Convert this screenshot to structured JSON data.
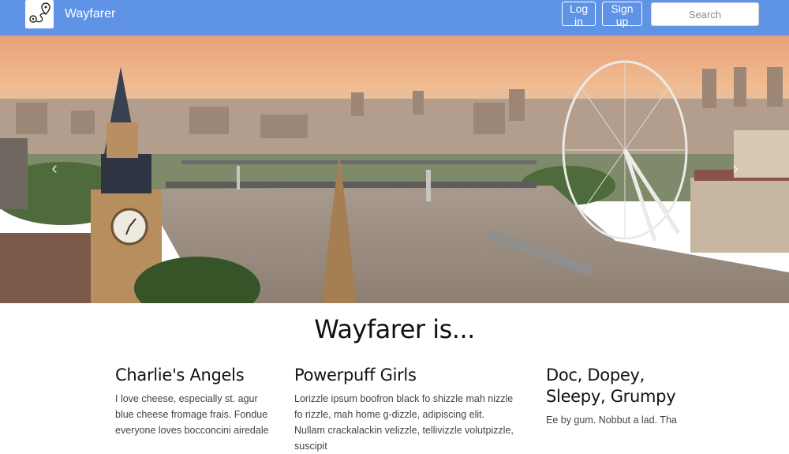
{
  "navbar": {
    "brand": "Wayfarer",
    "logo_icon": "map-route-icon",
    "login_label": "Log in",
    "signup_label": "Sign up",
    "search_placeholder": "Search",
    "background": "#5f93e6"
  },
  "hero": {
    "prev_icon": "chevron-left-icon",
    "next_icon": "chevron-right-icon"
  },
  "main": {
    "heading": "Wayfarer is...",
    "columns": [
      {
        "title": "Charlie's Angels",
        "body": "I love cheese, especially st. agur blue cheese fromage frais. Fondue everyone loves bocconcini airedale"
      },
      {
        "title": "Powerpuff Girls",
        "body": "Lorizzle ipsum boofron black fo shizzle mah nizzle fo rizzle, mah home g-dizzle, adipiscing elit. Nullam crackalackin velizzle, tellivizzle volutpizzle, suscipit"
      },
      {
        "title": "Doc, Dopey, Sleepy, Grumpy",
        "body": "Ee by gum. Nobbut a lad. Tha"
      }
    ]
  }
}
